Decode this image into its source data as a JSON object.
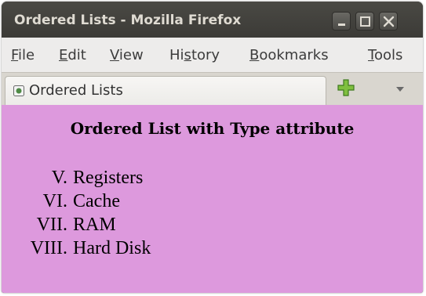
{
  "window": {
    "title": "Ordered Lists - Mozilla Firefox"
  },
  "menubar": {
    "items": [
      {
        "accel": "F",
        "rest": "ile"
      },
      {
        "accel": "E",
        "rest": "dit"
      },
      {
        "accel": "V",
        "rest": "iew"
      },
      {
        "pre": "Hi",
        "accel": "s",
        "rest": "tory"
      },
      {
        "accel": "B",
        "rest": "ookmarks"
      },
      {
        "accel": "T",
        "rest": "ools"
      }
    ]
  },
  "tabs": {
    "active_title": "Ordered Lists",
    "favicon": "page-icon",
    "new_tab_icon": "plus-icon",
    "list_all_icon": "chevron-down-icon"
  },
  "content": {
    "background": "#dd99dd",
    "heading": "Ordered List with Type attribute",
    "list": [
      {
        "marker": "V.",
        "text": "Registers"
      },
      {
        "marker": "VI.",
        "text": "Cache"
      },
      {
        "marker": "VII.",
        "text": "RAM"
      },
      {
        "marker": "VIII.",
        "text": "Hard Disk"
      }
    ]
  }
}
